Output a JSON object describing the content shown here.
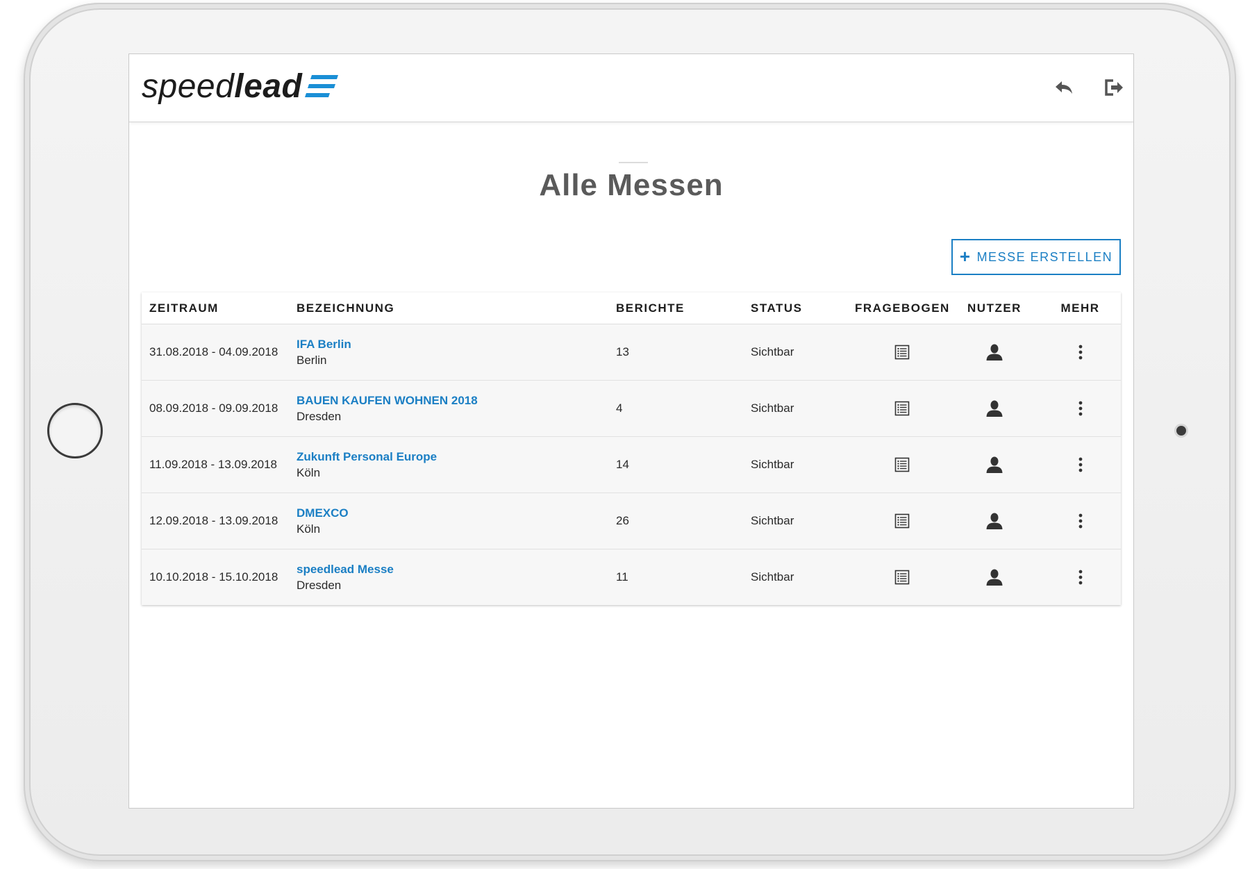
{
  "app": {
    "logo_text_regular": "speed",
    "logo_text_bold": "lead"
  },
  "colors": {
    "accent": "#1b7fc4",
    "logo_blue": "#1a8fd6",
    "text": "#2a2a2a",
    "title": "#5a5a5a"
  },
  "header": {
    "back_icon": "reply-arrow-icon",
    "logout_icon": "logout-icon"
  },
  "page": {
    "title": "Alle Messen"
  },
  "actions": {
    "create_label": "MESSE ERSTELLEN",
    "create_icon": "plus-icon"
  },
  "table": {
    "columns": {
      "zeitraum": "ZEITRAUM",
      "bezeichnung": "BEZEICHNUNG",
      "berichte": "BERICHTE",
      "status": "STATUS",
      "fragebogen": "FRAGEBOGEN",
      "nutzer": "NUTZER",
      "mehr": "MEHR"
    },
    "row_icons": {
      "fragebogen": "list-icon",
      "nutzer": "user-icon",
      "mehr": "more-vertical-icon"
    },
    "rows": [
      {
        "zeitraum": "31.08.2018 - 04.09.2018",
        "name": "IFA Berlin",
        "city": "Berlin",
        "berichte": "13",
        "status": "Sichtbar"
      },
      {
        "zeitraum": "08.09.2018 - 09.09.2018",
        "name": "BAUEN KAUFEN WOHNEN 2018",
        "city": "Dresden",
        "berichte": "4",
        "status": "Sichtbar"
      },
      {
        "zeitraum": "11.09.2018 - 13.09.2018",
        "name": "Zukunft Personal Europe",
        "city": "Köln",
        "berichte": "14",
        "status": "Sichtbar"
      },
      {
        "zeitraum": "12.09.2018 - 13.09.2018",
        "name": "DMEXCO",
        "city": "Köln",
        "berichte": "26",
        "status": "Sichtbar"
      },
      {
        "zeitraum": "10.10.2018 - 15.10.2018",
        "name": "speedlead Messe",
        "city": "Dresden",
        "berichte": "11",
        "status": "Sichtbar"
      }
    ]
  }
}
